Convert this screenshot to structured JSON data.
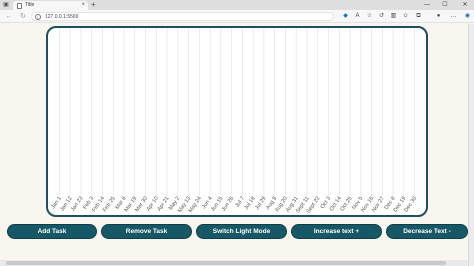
{
  "browser": {
    "tab_title": "Title",
    "tab_close": "×",
    "new_tab": "+",
    "url": "127.0.0.1:5500",
    "minimize": "—",
    "maximize": "☐",
    "close": "✕"
  },
  "buttons": {
    "add_task": "Add Task",
    "remove_task": "Remove Task",
    "switch_mode": "Switch Light Mode",
    "increase_text": "Increase text +",
    "decrease_text": "Decrease Text -"
  },
  "chart_data": {
    "type": "gantt",
    "x_tick_labels": [
      "Jan 1",
      "Jan 12",
      "Jan 23",
      "Feb 3",
      "Feb 14",
      "Feb 25",
      "Mar 8",
      "Mar 19",
      "Mar 30",
      "Apr 10",
      "Apr 21",
      "May 2",
      "May 13",
      "May 24",
      "Jun 4",
      "Jun 15",
      "Jun 26",
      "Jul 7",
      "Jul 18",
      "Jul 29",
      "Aug 9",
      "Aug 20",
      "Aug 31",
      "Sept 11",
      "Sept 22",
      "Oct 3",
      "Oct 14",
      "Oct 25",
      "Nov 5",
      "Nov 16",
      "Nov 27",
      "Dec 8",
      "Dec 19",
      "Dec 30"
    ],
    "tasks": [],
    "grid": true
  }
}
